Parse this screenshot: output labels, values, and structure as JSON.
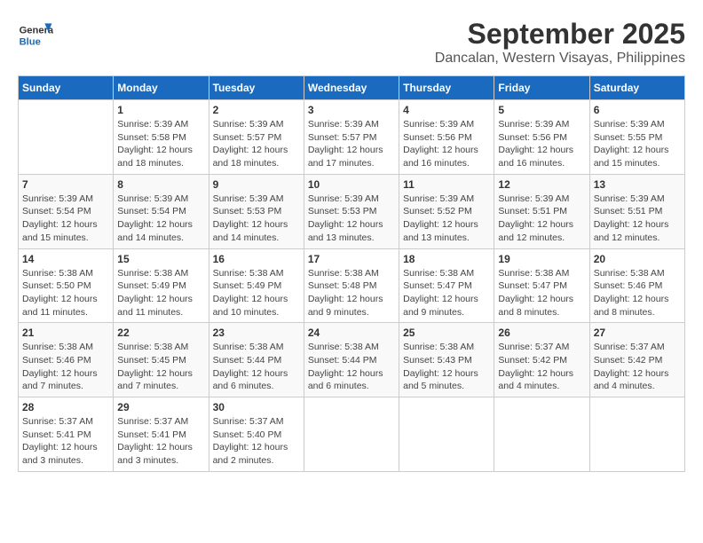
{
  "logo": {
    "line1": "General",
    "line2": "Blue"
  },
  "title": "September 2025",
  "subtitle": "Dancalan, Western Visayas, Philippines",
  "headers": [
    "Sunday",
    "Monday",
    "Tuesday",
    "Wednesday",
    "Thursday",
    "Friday",
    "Saturday"
  ],
  "weeks": [
    [
      {
        "day": "",
        "info": ""
      },
      {
        "day": "1",
        "info": "Sunrise: 5:39 AM\nSunset: 5:58 PM\nDaylight: 12 hours\nand 18 minutes."
      },
      {
        "day": "2",
        "info": "Sunrise: 5:39 AM\nSunset: 5:57 PM\nDaylight: 12 hours\nand 18 minutes."
      },
      {
        "day": "3",
        "info": "Sunrise: 5:39 AM\nSunset: 5:57 PM\nDaylight: 12 hours\nand 17 minutes."
      },
      {
        "day": "4",
        "info": "Sunrise: 5:39 AM\nSunset: 5:56 PM\nDaylight: 12 hours\nand 16 minutes."
      },
      {
        "day": "5",
        "info": "Sunrise: 5:39 AM\nSunset: 5:56 PM\nDaylight: 12 hours\nand 16 minutes."
      },
      {
        "day": "6",
        "info": "Sunrise: 5:39 AM\nSunset: 5:55 PM\nDaylight: 12 hours\nand 15 minutes."
      }
    ],
    [
      {
        "day": "7",
        "info": "Sunrise: 5:39 AM\nSunset: 5:54 PM\nDaylight: 12 hours\nand 15 minutes."
      },
      {
        "day": "8",
        "info": "Sunrise: 5:39 AM\nSunset: 5:54 PM\nDaylight: 12 hours\nand 14 minutes."
      },
      {
        "day": "9",
        "info": "Sunrise: 5:39 AM\nSunset: 5:53 PM\nDaylight: 12 hours\nand 14 minutes."
      },
      {
        "day": "10",
        "info": "Sunrise: 5:39 AM\nSunset: 5:53 PM\nDaylight: 12 hours\nand 13 minutes."
      },
      {
        "day": "11",
        "info": "Sunrise: 5:39 AM\nSunset: 5:52 PM\nDaylight: 12 hours\nand 13 minutes."
      },
      {
        "day": "12",
        "info": "Sunrise: 5:39 AM\nSunset: 5:51 PM\nDaylight: 12 hours\nand 12 minutes."
      },
      {
        "day": "13",
        "info": "Sunrise: 5:39 AM\nSunset: 5:51 PM\nDaylight: 12 hours\nand 12 minutes."
      }
    ],
    [
      {
        "day": "14",
        "info": "Sunrise: 5:38 AM\nSunset: 5:50 PM\nDaylight: 12 hours\nand 11 minutes."
      },
      {
        "day": "15",
        "info": "Sunrise: 5:38 AM\nSunset: 5:49 PM\nDaylight: 12 hours\nand 11 minutes."
      },
      {
        "day": "16",
        "info": "Sunrise: 5:38 AM\nSunset: 5:49 PM\nDaylight: 12 hours\nand 10 minutes."
      },
      {
        "day": "17",
        "info": "Sunrise: 5:38 AM\nSunset: 5:48 PM\nDaylight: 12 hours\nand 9 minutes."
      },
      {
        "day": "18",
        "info": "Sunrise: 5:38 AM\nSunset: 5:47 PM\nDaylight: 12 hours\nand 9 minutes."
      },
      {
        "day": "19",
        "info": "Sunrise: 5:38 AM\nSunset: 5:47 PM\nDaylight: 12 hours\nand 8 minutes."
      },
      {
        "day": "20",
        "info": "Sunrise: 5:38 AM\nSunset: 5:46 PM\nDaylight: 12 hours\nand 8 minutes."
      }
    ],
    [
      {
        "day": "21",
        "info": "Sunrise: 5:38 AM\nSunset: 5:46 PM\nDaylight: 12 hours\nand 7 minutes."
      },
      {
        "day": "22",
        "info": "Sunrise: 5:38 AM\nSunset: 5:45 PM\nDaylight: 12 hours\nand 7 minutes."
      },
      {
        "day": "23",
        "info": "Sunrise: 5:38 AM\nSunset: 5:44 PM\nDaylight: 12 hours\nand 6 minutes."
      },
      {
        "day": "24",
        "info": "Sunrise: 5:38 AM\nSunset: 5:44 PM\nDaylight: 12 hours\nand 6 minutes."
      },
      {
        "day": "25",
        "info": "Sunrise: 5:38 AM\nSunset: 5:43 PM\nDaylight: 12 hours\nand 5 minutes."
      },
      {
        "day": "26",
        "info": "Sunrise: 5:37 AM\nSunset: 5:42 PM\nDaylight: 12 hours\nand 4 minutes."
      },
      {
        "day": "27",
        "info": "Sunrise: 5:37 AM\nSunset: 5:42 PM\nDaylight: 12 hours\nand 4 minutes."
      }
    ],
    [
      {
        "day": "28",
        "info": "Sunrise: 5:37 AM\nSunset: 5:41 PM\nDaylight: 12 hours\nand 3 minutes."
      },
      {
        "day": "29",
        "info": "Sunrise: 5:37 AM\nSunset: 5:41 PM\nDaylight: 12 hours\nand 3 minutes."
      },
      {
        "day": "30",
        "info": "Sunrise: 5:37 AM\nSunset: 5:40 PM\nDaylight: 12 hours\nand 2 minutes."
      },
      {
        "day": "",
        "info": ""
      },
      {
        "day": "",
        "info": ""
      },
      {
        "day": "",
        "info": ""
      },
      {
        "day": "",
        "info": ""
      }
    ]
  ]
}
